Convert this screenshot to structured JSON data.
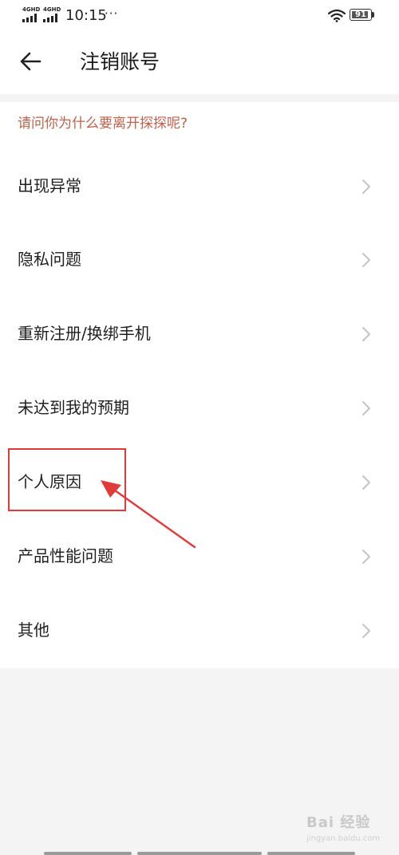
{
  "status_bar": {
    "network_1": "4GHD",
    "network_2": "4GHD",
    "time": "10:15",
    "more": "···",
    "wifi_icon": "wifi-icon",
    "battery": "91",
    "battery_level": 0.91
  },
  "app_bar": {
    "back_icon": "arrow-left-icon",
    "title": "注销账号"
  },
  "question": "请问你为什么要离开探探呢?",
  "reasons": [
    {
      "label": "出现异常"
    },
    {
      "label": "隐私问题"
    },
    {
      "label": "重新注册/换绑手机"
    },
    {
      "label": "未达到我的预期"
    },
    {
      "label": "个人原因"
    },
    {
      "label": "产品性能问题"
    },
    {
      "label": "其他"
    }
  ],
  "colors": {
    "question_text": "#c0614a",
    "annotation": "#e03a3a",
    "background": "#f4f4f4"
  },
  "watermark": {
    "text": "Bai 经验",
    "sub": "jingyan.baidu.com"
  }
}
